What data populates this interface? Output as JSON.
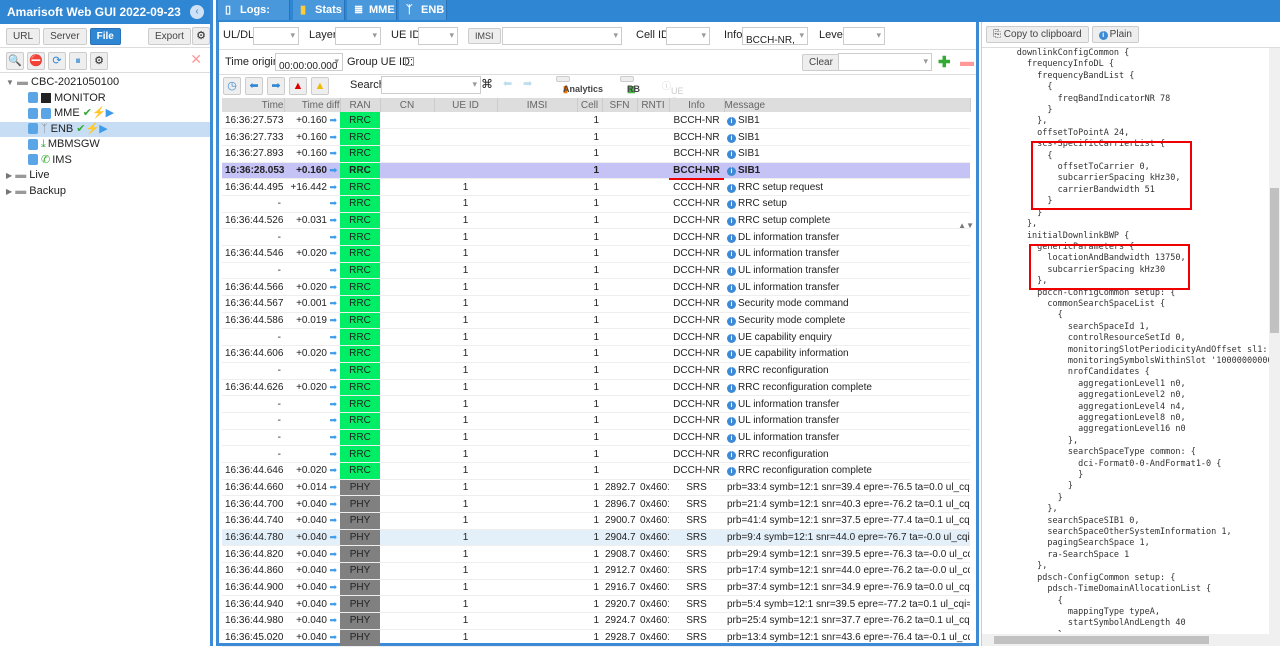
{
  "app": {
    "title": "Amarisoft Web GUI 2022-09-23"
  },
  "sidebar": {
    "buttons": {
      "url": "URL",
      "server": "Server",
      "file": "File",
      "export": "Export"
    },
    "tree": {
      "root": "CBC-2021050100",
      "items": [
        "MONITOR",
        "MME",
        "ENB",
        "MBMSGW",
        "IMS"
      ],
      "folders": [
        "Live",
        "Backup"
      ]
    }
  },
  "tabs": [
    {
      "label": "Logs: 1109",
      "icon": "document-icon"
    },
    {
      "label": "Stats",
      "icon": "chart-icon"
    },
    {
      "label": "MME",
      "icon": "database-icon"
    },
    {
      "label": "ENB",
      "icon": "antenna-icon"
    }
  ],
  "filters": {
    "uldl": "UL/DL",
    "layer": "Layer",
    "ueid": "UE ID",
    "imsi": "IMSI",
    "cellid": "Cell ID",
    "info": "Info",
    "info_value": "BCCH-NR,",
    "level": "Level",
    "time_origin": "Time origin:",
    "time_origin_value": "00:00:00.000",
    "group_ue": "Group UE ID:",
    "clear": "Clear",
    "search": "Search",
    "analytics": "Analytics",
    "rb": "RB",
    "uecaps": "UE Caps"
  },
  "table": {
    "columns": [
      "Time",
      "Time diff",
      "RAN",
      "CN",
      "UE ID",
      "IMSI",
      "Cell",
      "SFN",
      "RNTI",
      "Info",
      "Message"
    ],
    "rows": [
      [
        "16:36:27.573",
        "+0.160",
        "RRC",
        "",
        "",
        "",
        "1",
        "",
        "",
        "BCCH-NR",
        "SIB1"
      ],
      [
        "16:36:27.733",
        "+0.160",
        "RRC",
        "",
        "",
        "",
        "1",
        "",
        "",
        "BCCH-NR",
        "SIB1"
      ],
      [
        "16:36:27.893",
        "+0.160",
        "RRC",
        "",
        "",
        "",
        "1",
        "",
        "",
        "BCCH-NR",
        "SIB1"
      ],
      [
        "16:36:28.053",
        "+0.160",
        "RRC",
        "",
        "",
        "",
        "1",
        "",
        "",
        "BCCH-NR",
        "SIB1"
      ],
      [
        "16:36:44.495",
        "+16.442",
        "RRC",
        "",
        "1",
        "",
        "1",
        "",
        "",
        "CCCH-NR",
        "RRC setup request"
      ],
      [
        "-",
        "",
        "RRC",
        "",
        "1",
        "",
        "1",
        "",
        "",
        "CCCH-NR",
        "RRC setup"
      ],
      [
        "16:36:44.526",
        "+0.031",
        "RRC",
        "",
        "1",
        "",
        "1",
        "",
        "",
        "DCCH-NR",
        "RRC setup complete"
      ],
      [
        "-",
        "",
        "RRC",
        "",
        "1",
        "",
        "1",
        "",
        "",
        "DCCH-NR",
        "DL information transfer"
      ],
      [
        "16:36:44.546",
        "+0.020",
        "RRC",
        "",
        "1",
        "",
        "1",
        "",
        "",
        "DCCH-NR",
        "UL information transfer"
      ],
      [
        "-",
        "",
        "RRC",
        "",
        "1",
        "",
        "1",
        "",
        "",
        "DCCH-NR",
        "UL information transfer"
      ],
      [
        "16:36:44.566",
        "+0.020",
        "RRC",
        "",
        "1",
        "",
        "1",
        "",
        "",
        "DCCH-NR",
        "UL information transfer"
      ],
      [
        "16:36:44.567",
        "+0.001",
        "RRC",
        "",
        "1",
        "",
        "1",
        "",
        "",
        "DCCH-NR",
        "Security mode command"
      ],
      [
        "16:36:44.586",
        "+0.019",
        "RRC",
        "",
        "1",
        "",
        "1",
        "",
        "",
        "DCCH-NR",
        "Security mode complete"
      ],
      [
        "-",
        "",
        "RRC",
        "",
        "1",
        "",
        "1",
        "",
        "",
        "DCCH-NR",
        "UE capability enquiry"
      ],
      [
        "16:36:44.606",
        "+0.020",
        "RRC",
        "",
        "1",
        "",
        "1",
        "",
        "",
        "DCCH-NR",
        "UE capability information"
      ],
      [
        "-",
        "",
        "RRC",
        "",
        "1",
        "",
        "1",
        "",
        "",
        "DCCH-NR",
        "RRC reconfiguration"
      ],
      [
        "16:36:44.626",
        "+0.020",
        "RRC",
        "",
        "1",
        "",
        "1",
        "",
        "",
        "DCCH-NR",
        "RRC reconfiguration complete"
      ],
      [
        "-",
        "",
        "RRC",
        "",
        "1",
        "",
        "1",
        "",
        "",
        "DCCH-NR",
        "UL information transfer"
      ],
      [
        "-",
        "",
        "RRC",
        "",
        "1",
        "",
        "1",
        "",
        "",
        "DCCH-NR",
        "UL information transfer"
      ],
      [
        "-",
        "",
        "RRC",
        "",
        "1",
        "",
        "1",
        "",
        "",
        "DCCH-NR",
        "UL information transfer"
      ],
      [
        "-",
        "",
        "RRC",
        "",
        "1",
        "",
        "1",
        "",
        "",
        "DCCH-NR",
        "RRC reconfiguration"
      ],
      [
        "16:36:44.646",
        "+0.020",
        "RRC",
        "",
        "1",
        "",
        "1",
        "",
        "",
        "DCCH-NR",
        "RRC reconfiguration complete"
      ],
      [
        "16:36:44.660",
        "+0.014",
        "PHY",
        "",
        "1",
        "",
        "1",
        "2892.7",
        "0x4601",
        "SRS",
        "prb=33:4 symb=12:1 snr=39.4 epre=-76.5 ta=0.0 ul_cqi=15"
      ],
      [
        "16:36:44.700",
        "+0.040",
        "PHY",
        "",
        "1",
        "",
        "1",
        "2896.7",
        "0x4601",
        "SRS",
        "prb=21:4 symb=12:1 snr=40.3 epre=-76.2 ta=0.1 ul_cqi=15"
      ],
      [
        "16:36:44.740",
        "+0.040",
        "PHY",
        "",
        "1",
        "",
        "1",
        "2900.7",
        "0x4601",
        "SRS",
        "prb=41:4 symb=12:1 snr=37.5 epre=-77.4 ta=0.1 ul_cqi=15"
      ],
      [
        "16:36:44.780",
        "+0.040",
        "PHY",
        "",
        "1",
        "",
        "1",
        "2904.7",
        "0x4601",
        "SRS",
        "prb=9:4 symb=12:1 snr=44.0 epre=-76.7 ta=-0.0 ul_cqi=15"
      ],
      [
        "16:36:44.820",
        "+0.040",
        "PHY",
        "",
        "1",
        "",
        "1",
        "2908.7",
        "0x4601",
        "SRS",
        "prb=29:4 symb=12:1 snr=39.5 epre=-76.3 ta=-0.0 ul_cqi=15"
      ],
      [
        "16:36:44.860",
        "+0.040",
        "PHY",
        "",
        "1",
        "",
        "1",
        "2912.7",
        "0x4601",
        "SRS",
        "prb=17:4 symb=12:1 snr=44.0 epre=-76.2 ta=-0.0 ul_cqi=15"
      ],
      [
        "16:36:44.900",
        "+0.040",
        "PHY",
        "",
        "1",
        "",
        "1",
        "2916.7",
        "0x4601",
        "SRS",
        "prb=37:4 symb=12:1 snr=34.9 epre=-76.9 ta=0.0 ul_cqi=15"
      ],
      [
        "16:36:44.940",
        "+0.040",
        "PHY",
        "",
        "1",
        "",
        "1",
        "2920.7",
        "0x4601",
        "SRS",
        "prb=5:4 symb=12:1 snr=39.5 epre=-77.2 ta=0.1 ul_cqi=15"
      ],
      [
        "16:36:44.980",
        "+0.040",
        "PHY",
        "",
        "1",
        "",
        "1",
        "2924.7",
        "0x4601",
        "SRS",
        "prb=25:4 symb=12:1 snr=37.7 epre=-76.2 ta=0.1 ul_cqi=15"
      ],
      [
        "16:36:45.020",
        "+0.040",
        "PHY",
        "",
        "1",
        "",
        "1",
        "2928.7",
        "0x4601",
        "SRS",
        "prb=13:4 symb=12:1 snr=43.6 epre=-76.4 ta=-0.1 ul_cqi=15"
      ]
    ],
    "selected_row": 3,
    "hover_row": 25
  },
  "detail": {
    "copy": "Copy to clipboard",
    "plain": "Plain",
    "code": "      downlinkConfigCommon {\n        frequencyInfoDL {\n          frequencyBandList {\n            {\n              freqBandIndicatorNR 78\n            }\n          },\n          offsetToPointA 24,\n          scs-SpecificCarrierList {\n            {\n              offsetToCarrier 0,\n              subcarrierSpacing kHz30,\n              carrierBandwidth 51\n            }\n          }\n        },\n        initialDownlinkBWP {\n          genericParameters {\n            locationAndBandwidth 13750,\n            subcarrierSpacing kHz30\n          },\n          pdcch-ConfigCommon setup: {\n            commonSearchSpaceList {\n              {\n                searchSpaceId 1,\n                controlResourceSetId 0,\n                monitoringSlotPeriodicityAndOffset sl1: NULL,\n                monitoringSymbolsWithinSlot '10000000000000'B,\n                nrofCandidates {\n                  aggregationLevel1 n0,\n                  aggregationLevel2 n0,\n                  aggregationLevel4 n4,\n                  aggregationLevel8 n0,\n                  aggregationLevel16 n0\n                },\n                searchSpaceType common: {\n                  dci-Format0-0-AndFormat1-0 {\n                  }\n                }\n              }\n            },\n            searchSpaceSIB1 0,\n            searchSpaceOtherSystemInformation 1,\n            pagingSearchSpace 1,\n            ra-SearchSpace 1\n          },\n          pdsch-ConfigCommon setup: {\n            pdsch-TimeDomainAllocationList {\n              {\n                mappingType typeA,\n                startSymbolAndLength 40\n              },"
  }
}
